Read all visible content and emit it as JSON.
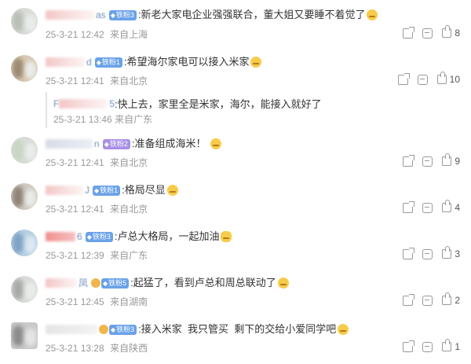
{
  "comments": [
    {
      "name_tail": "as",
      "badge": "铁粉3",
      "badge_style": "blue",
      "text": ":新老大家电企业强强联合，董大姐又要睡不着觉了",
      "emoji": "smile-emoji",
      "date": "25-3-21 12:42",
      "location": "来自上海",
      "likes": "8"
    },
    {
      "name_tail": "d",
      "badge": "铁粉1",
      "badge_style": "blue",
      "text": ":希望海尔家电可以接入米家",
      "emoji": "laugh-emoji",
      "date": "25-3-21 12:41",
      "location": "来自北京",
      "likes": "10",
      "reply": {
        "name_head": "F",
        "name_tail": "5",
        "text": ":快上去，家里全是米家，海尔，能接入就好了",
        "date": "25-3-21 13:46",
        "location": "来自广东"
      }
    },
    {
      "name_tail": "n",
      "badge": "铁粉2",
      "badge_style": "purple",
      "text": ":准备组成海米！",
      "emoji": "smile-emoji",
      "date": "25-3-21 12:41",
      "location": "来自北京",
      "likes": "9"
    },
    {
      "name_tail": "J",
      "badge": "铁粉1",
      "badge_style": "blue",
      "text": ":格局尽显",
      "emoji": "star-eyes-emoji",
      "date": "25-3-21 12:41",
      "location": "来自北京",
      "likes": "4"
    },
    {
      "name_tail": "6",
      "badge": "铁粉3",
      "badge_style": "blue",
      "text": ":卢总大格局，一起加油",
      "emoji": "fist-emoji",
      "date": "25-3-21 12:39",
      "location": "来自广东",
      "likes": "3"
    },
    {
      "name_tail": "凤",
      "badge": "铁粉5",
      "badge_style": "blue",
      "text": ":起猛了，看到卢总和周总联动了",
      "emoji": "laugh-emoji",
      "date": "25-3-21 12:45",
      "location": "来自湖南",
      "likes": "2"
    },
    {
      "name_tail": "",
      "badge": "铁粉3",
      "badge_style": "blue",
      "text": ":接入米家  我只管买  剩下的交给小爱同学吧",
      "emoji": "smile-emoji",
      "date": "25-3-21 13:28",
      "location": "来自陕西",
      "likes": "1"
    }
  ]
}
